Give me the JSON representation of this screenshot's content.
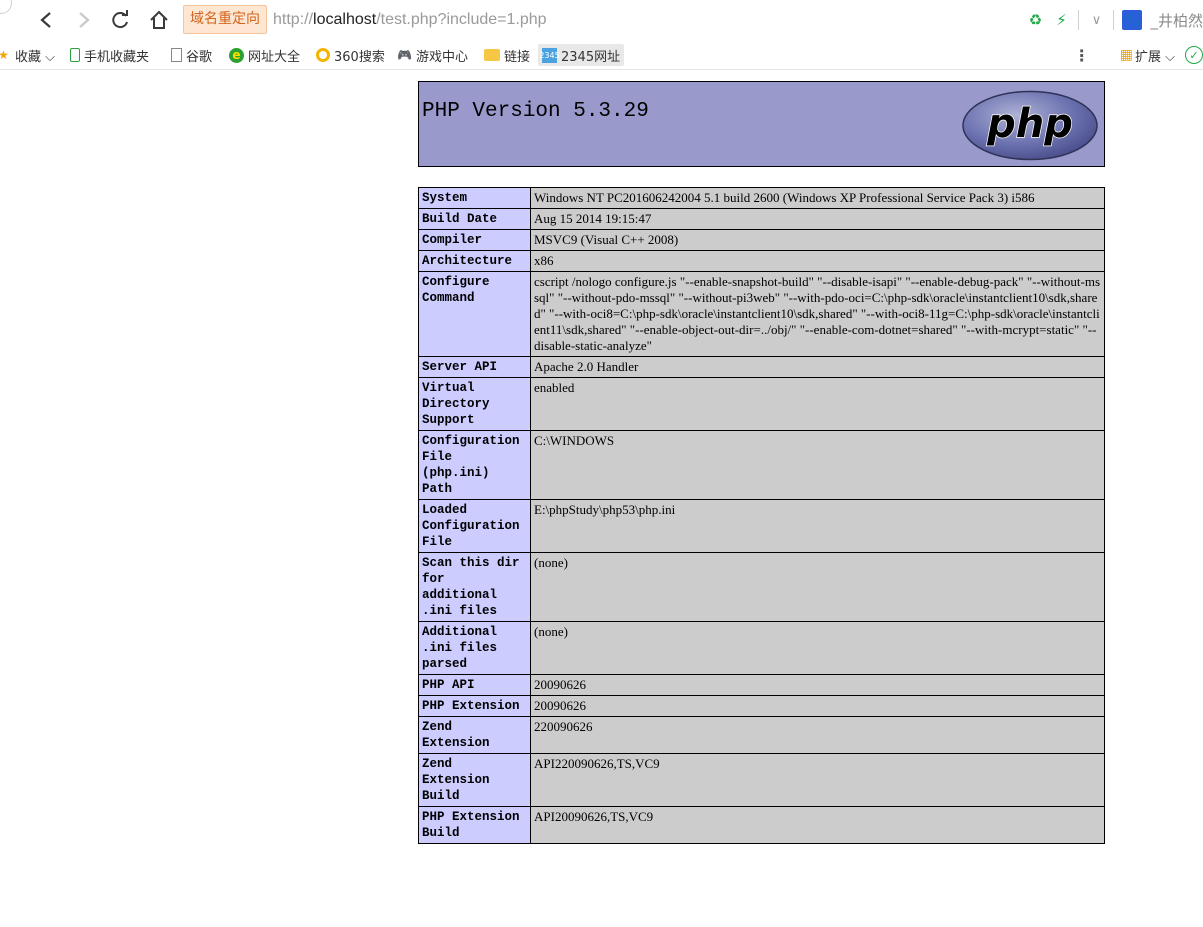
{
  "browser": {
    "redirect_badge": "域名重定向",
    "url_prefix": "http://",
    "url_host": "localhost",
    "url_path": "/test.php?include=1.php",
    "user_label": "_井柏然",
    "accent_color": "#25a84a"
  },
  "bookmarks": {
    "favorites": "收藏 ⌵",
    "items": [
      "手机收藏夹",
      "谷歌",
      "网址大全",
      "360搜索",
      "游戏中心",
      "链接",
      "2345网址"
    ],
    "extensions": "扩展 ⌵"
  },
  "php": {
    "version_title": "PHP Version 5.3.29",
    "logo_text": "php",
    "header_color": "#9999cc",
    "key_color": "#ccccff",
    "value_color": "#cccccc",
    "rows": [
      {
        "key": "System",
        "value": "Windows NT PC201606242004 5.1 build 2600 (Windows XP Professional Service Pack 3) i586"
      },
      {
        "key": "Build Date",
        "value": "Aug 15 2014 19:15:47"
      },
      {
        "key": "Compiler",
        "value": "MSVC9 (Visual C++ 2008)"
      },
      {
        "key": "Architecture",
        "value": "x86"
      },
      {
        "key": "Configure Command",
        "value": "cscript /nologo configure.js \"--enable-snapshot-build\" \"--disable-isapi\" \"--enable-debug-pack\" \"--without-mssql\" \"--without-pdo-mssql\" \"--without-pi3web\" \"--with-pdo-oci=C:\\php-sdk\\oracle\\instantclient10\\sdk,shared\" \"--with-oci8=C:\\php-sdk\\oracle\\instantclient10\\sdk,shared\" \"--with-oci8-11g=C:\\php-sdk\\oracle\\instantclient11\\sdk,shared\" \"--enable-object-out-dir=../obj/\" \"--enable-com-dotnet=shared\" \"--with-mcrypt=static\" \"--disable-static-analyze\""
      },
      {
        "key": "Server API",
        "value": "Apache 2.0 Handler"
      },
      {
        "key": "Virtual Directory Support",
        "value": "enabled"
      },
      {
        "key": "Configuration File (php.ini) Path",
        "value": "C:\\WINDOWS"
      },
      {
        "key": "Loaded Configuration File",
        "value": "E:\\phpStudy\\php53\\php.ini"
      },
      {
        "key": "Scan this dir for additional .ini files",
        "value": "(none)"
      },
      {
        "key": "Additional .ini files parsed",
        "value": "(none)"
      },
      {
        "key": "PHP API",
        "value": "20090626"
      },
      {
        "key": "PHP Extension",
        "value": "20090626"
      },
      {
        "key": "Zend Extension",
        "value": "220090626"
      },
      {
        "key": "Zend Extension Build",
        "value": "API220090626,TS,VC9"
      },
      {
        "key": "PHP Extension Build",
        "value": "API20090626,TS,VC9"
      }
    ]
  }
}
